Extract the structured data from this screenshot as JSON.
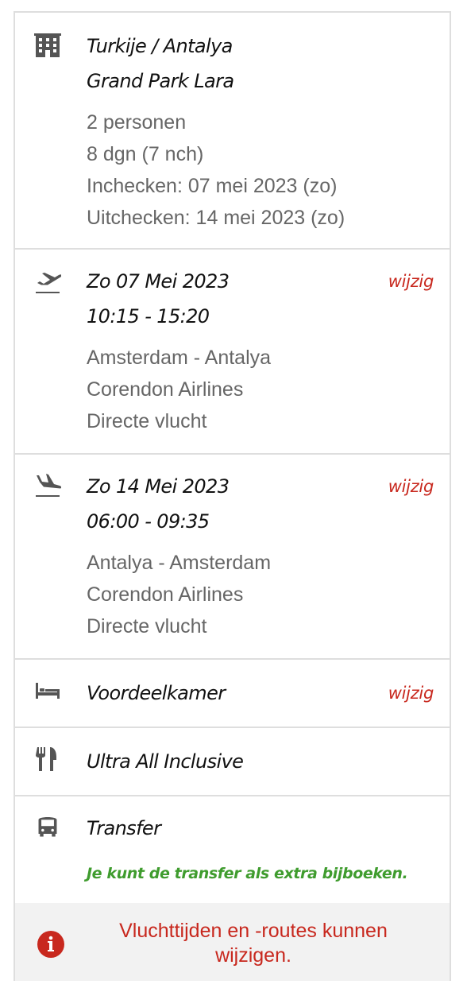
{
  "hotel": {
    "icon": "building-icon",
    "location": "Turkije / Antalya",
    "name": "Grand Park Lara",
    "details": [
      "2 personen",
      "8 dgn (7 nch)",
      "Inchecken: 07 mei 2023 (zo)",
      "Uitchecken: 14 mei 2023 (zo)"
    ]
  },
  "outbound": {
    "icon": "plane-takeoff-icon",
    "date": "Zo 07 Mei 2023",
    "time": "10:15 - 15:20",
    "edit_label": "wijzig",
    "details": [
      "Amsterdam - Antalya",
      "Corendon Airlines",
      "Directe vlucht"
    ]
  },
  "return": {
    "icon": "plane-landing-icon",
    "date": "Zo 14 Mei 2023",
    "time": "06:00 - 09:35",
    "edit_label": "wijzig",
    "details": [
      "Antalya - Amsterdam",
      "Corendon Airlines",
      "Directe vlucht"
    ]
  },
  "room": {
    "icon": "bed-icon",
    "label": "Voordeelkamer",
    "edit_label": "wijzig"
  },
  "board": {
    "icon": "utensils-icon",
    "label": "Ultra All Inclusive"
  },
  "transfer": {
    "icon": "bus-icon",
    "label": "Transfer",
    "note": "Je kunt de transfer als extra bijboeken."
  },
  "notice": {
    "icon": "info-icon",
    "text": "Vluchttijden en -routes kunnen wijzigen."
  },
  "colors": {
    "accent_red": "#c8281e",
    "green": "#3f9c2e",
    "icon_gray": "#555555",
    "border": "#dedede"
  }
}
